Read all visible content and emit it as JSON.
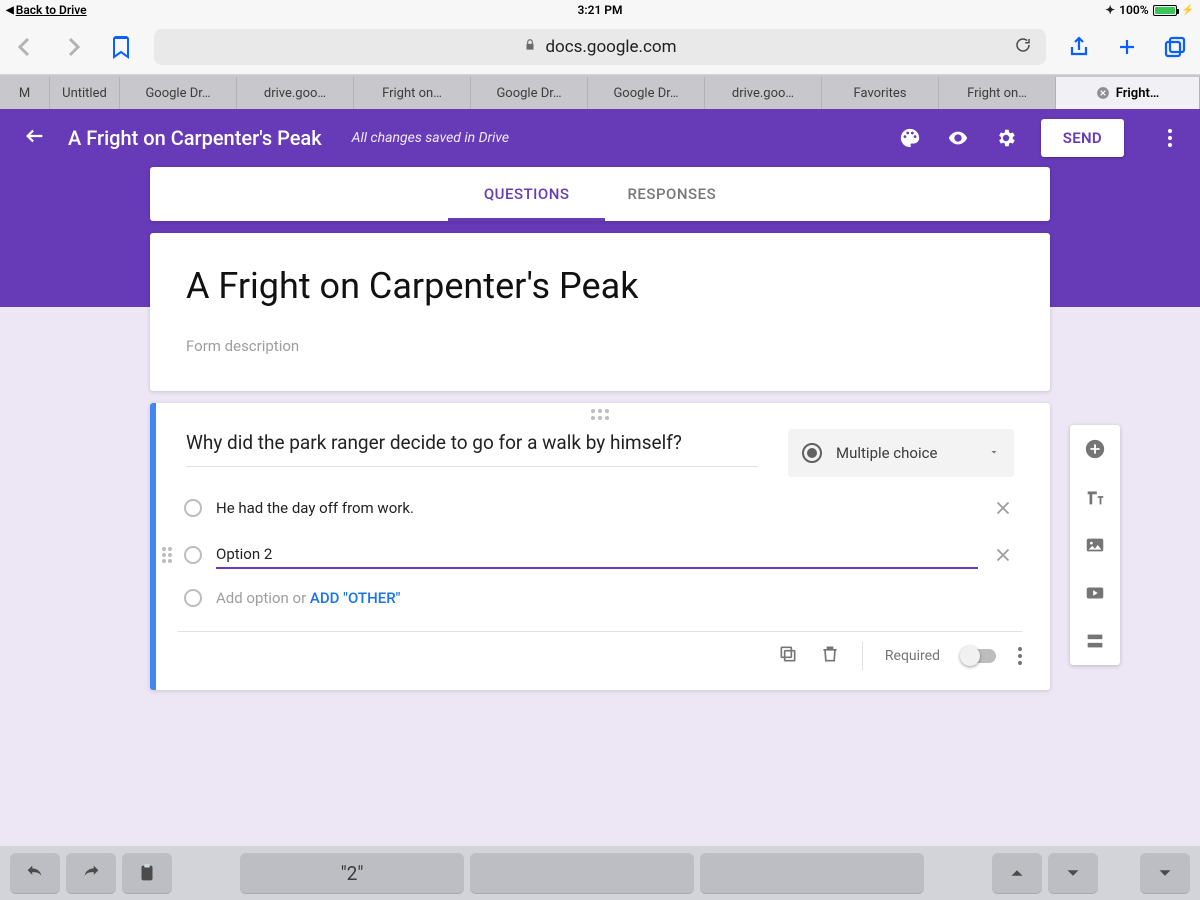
{
  "statusbar": {
    "back_label": "Back to Drive",
    "time": "3:21 PM",
    "battery_pct": "100%"
  },
  "safari": {
    "url": "docs.google.com"
  },
  "browser_tabs": [
    {
      "label": "M"
    },
    {
      "label": "Untitled"
    },
    {
      "label": "Google Dr…"
    },
    {
      "label": "drive.goo…"
    },
    {
      "label": "Fright on…"
    },
    {
      "label": "Google Dr…"
    },
    {
      "label": "Google Dr…"
    },
    {
      "label": "drive.goo…"
    },
    {
      "label": "Favorites"
    },
    {
      "label": "Fright on…"
    },
    {
      "label": "Fright…",
      "active": true
    }
  ],
  "forms_header": {
    "title": "A Fright on Carpenter's Peak",
    "saved": "All changes saved in Drive",
    "send": "SEND"
  },
  "form_tabs": {
    "questions": "QUESTIONS",
    "responses": "RESPONSES"
  },
  "title_card": {
    "title": "A Fright on Carpenter's Peak",
    "desc_placeholder": "Form description"
  },
  "question": {
    "text": "Why did the park ranger decide to go for a walk by himself?",
    "type_label": "Multiple choice",
    "option1": "He had the day off from work.",
    "option2": "Option 2",
    "add_option": "Add option",
    "or": "or",
    "add_other": "ADD \"OTHER\"",
    "required": "Required"
  },
  "keyboard": {
    "suggestion": "\"2\""
  }
}
